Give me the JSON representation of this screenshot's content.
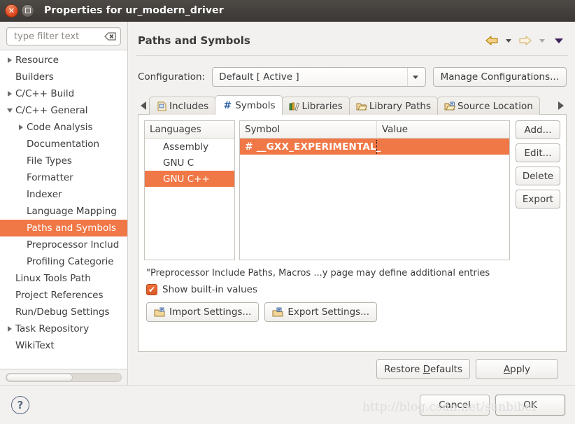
{
  "window": {
    "title": "Properties for ur_modern_driver",
    "close_glyph": "✕"
  },
  "sidebar": {
    "filter": {
      "placeholder": "type filter text",
      "value": "",
      "clear_icon": "clear-icon"
    },
    "items": [
      {
        "label": "Resource",
        "indent": 0,
        "twisty": "right",
        "selected": false
      },
      {
        "label": "Builders",
        "indent": 0,
        "twisty": "none",
        "selected": false
      },
      {
        "label": "C/C++ Build",
        "indent": 0,
        "twisty": "right",
        "selected": false
      },
      {
        "label": "C/C++ General",
        "indent": 0,
        "twisty": "down",
        "selected": false
      },
      {
        "label": "Code Analysis",
        "indent": 1,
        "twisty": "right",
        "selected": false
      },
      {
        "label": "Documentation",
        "indent": 1,
        "twisty": "none",
        "selected": false
      },
      {
        "label": "File Types",
        "indent": 1,
        "twisty": "none",
        "selected": false
      },
      {
        "label": "Formatter",
        "indent": 1,
        "twisty": "none",
        "selected": false
      },
      {
        "label": "Indexer",
        "indent": 1,
        "twisty": "none",
        "selected": false
      },
      {
        "label": "Language Mapping",
        "indent": 1,
        "twisty": "none",
        "selected": false
      },
      {
        "label": "Paths and Symbols",
        "indent": 1,
        "twisty": "none",
        "selected": true
      },
      {
        "label": "Preprocessor Includ",
        "indent": 1,
        "twisty": "none",
        "selected": false
      },
      {
        "label": "Profiling Categorie",
        "indent": 1,
        "twisty": "none",
        "selected": false
      },
      {
        "label": "Linux Tools Path",
        "indent": 0,
        "twisty": "none",
        "selected": false
      },
      {
        "label": "Project References",
        "indent": 0,
        "twisty": "none",
        "selected": false
      },
      {
        "label": "Run/Debug Settings",
        "indent": 0,
        "twisty": "none",
        "selected": false
      },
      {
        "label": "Task Repository",
        "indent": 0,
        "twisty": "right",
        "selected": false
      },
      {
        "label": "WikiText",
        "indent": 0,
        "twisty": "none",
        "selected": false
      }
    ],
    "scroll_thumb_percent": 58
  },
  "page": {
    "title": "Paths and Symbols",
    "nav": {
      "back_icon": "back-arrow-icon",
      "back_menu_icon": "chevron-down-icon",
      "forward_icon": "forward-arrow-icon",
      "forward_menu_icon": "chevron-down-icon",
      "view_menu_icon": "chevron-down-icon"
    }
  },
  "configuration": {
    "label": "Configuration:",
    "value": "Default  [ Active ]",
    "dropdown_icon": "chevron-down-icon",
    "manage_button": "Manage Configurations..."
  },
  "tabs": {
    "scroll_left_icon": "chevron-left-icon",
    "scroll_right_icon": "chevron-right-icon",
    "items": [
      {
        "label": "Includes",
        "icon": "includes-icon",
        "active": false
      },
      {
        "label": "Symbols",
        "icon": "hash-icon",
        "active": true
      },
      {
        "label": "Libraries",
        "icon": "libraries-icon",
        "active": false
      },
      {
        "label": "Library Paths",
        "icon": "folder-open-icon",
        "active": false
      },
      {
        "label": "Source Location",
        "icon": "source-folder-icon",
        "active": false
      }
    ]
  },
  "languages_table": {
    "header": "Languages",
    "rows": [
      {
        "label": "Assembly",
        "selected": false
      },
      {
        "label": "GNU C",
        "selected": false
      },
      {
        "label": "GNU C++",
        "selected": true
      }
    ]
  },
  "symbols_table": {
    "headers": [
      "Symbol",
      "Value"
    ],
    "rows": [
      {
        "icon": "hash-icon",
        "symbol": "__GXX_EXPERIMENTAL_",
        "value": "",
        "selected": true,
        "editing": true
      }
    ]
  },
  "side_buttons": [
    {
      "label": "Add...",
      "name": "add-button"
    },
    {
      "label": "Edit...",
      "name": "edit-button"
    },
    {
      "label": "Delete",
      "name": "delete-button"
    },
    {
      "label": "Export",
      "name": "export-button"
    }
  ],
  "note": "\"Preprocessor Include Paths, Macros ...y page may define additional entries",
  "show_builtin": {
    "label": "Show built-in values",
    "checked": true,
    "check_glyph": "✔"
  },
  "settings_buttons": {
    "import": {
      "label": "Import Settings...",
      "icon": "import-icon"
    },
    "export": {
      "label": "Export Settings...",
      "icon": "export-icon"
    }
  },
  "apply_row": {
    "restore_defaults_pre": "Restore ",
    "restore_defaults_mn": "D",
    "restore_defaults_post": "efaults",
    "apply_mn": "A",
    "apply_post": "pply"
  },
  "dialog_footer": {
    "help_glyph": "?",
    "cancel": "Cancel",
    "ok": "OK"
  },
  "watermark": "http://blog.csdn.net/sunbibei",
  "colors": {
    "selection_orange": "#f07746",
    "titlebar": "#3f3b37",
    "hash_blue": "#2b63a6"
  }
}
